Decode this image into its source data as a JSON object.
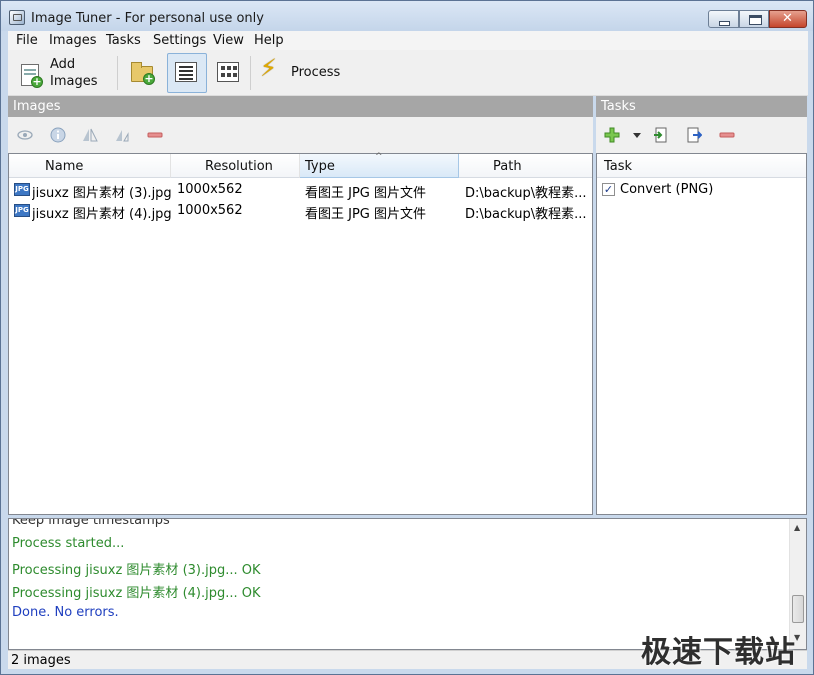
{
  "window": {
    "title": "Image Tuner - For personal use only"
  },
  "menu": [
    "File",
    "Images",
    "Tasks",
    "Settings",
    "View",
    "Help"
  ],
  "toolbar": {
    "add_images_line1": "Add",
    "add_images_line2": "Images",
    "process_label": "Process",
    "icons": [
      "add-images-icon",
      "add-folder-icon",
      "list-view-icon",
      "thumbnail-view-icon",
      "process-bolt-icon"
    ]
  },
  "images_panel": {
    "header": "Images",
    "columns": [
      "Name",
      "Resolution",
      "Type",
      "Path"
    ],
    "rows": [
      {
        "name": "jisuxz 图片素材 (3).jpg",
        "resolution": "1000x562",
        "type": "看图王 JPG 图片文件",
        "path": "D:\\backup\\教程素..."
      },
      {
        "name": "jisuxz 图片素材 (4).jpg",
        "resolution": "1000x562",
        "type": "看图王 JPG 图片文件",
        "path": "D:\\backup\\教程素..."
      }
    ]
  },
  "tasks_panel": {
    "header": "Tasks",
    "column": "Task",
    "items": [
      {
        "label": "Convert (PNG)",
        "checked": true
      }
    ]
  },
  "log": {
    "lines": [
      {
        "text": "Keep image timestamps",
        "color": "#333333"
      },
      {
        "text": "Process started...",
        "color": "#2e8b2e"
      },
      {
        "text": "Processing jisuxz 图片素材 (3).jpg... OK",
        "color": "#2e8b2e"
      },
      {
        "text": "Processing jisuxz 图片素材 (4).jpg... OK",
        "color": "#2e8b2e"
      },
      {
        "text": "Done. No errors.",
        "color": "#1f3fbf"
      }
    ]
  },
  "status": {
    "text": "2 images"
  },
  "watermark": "极速下载站"
}
